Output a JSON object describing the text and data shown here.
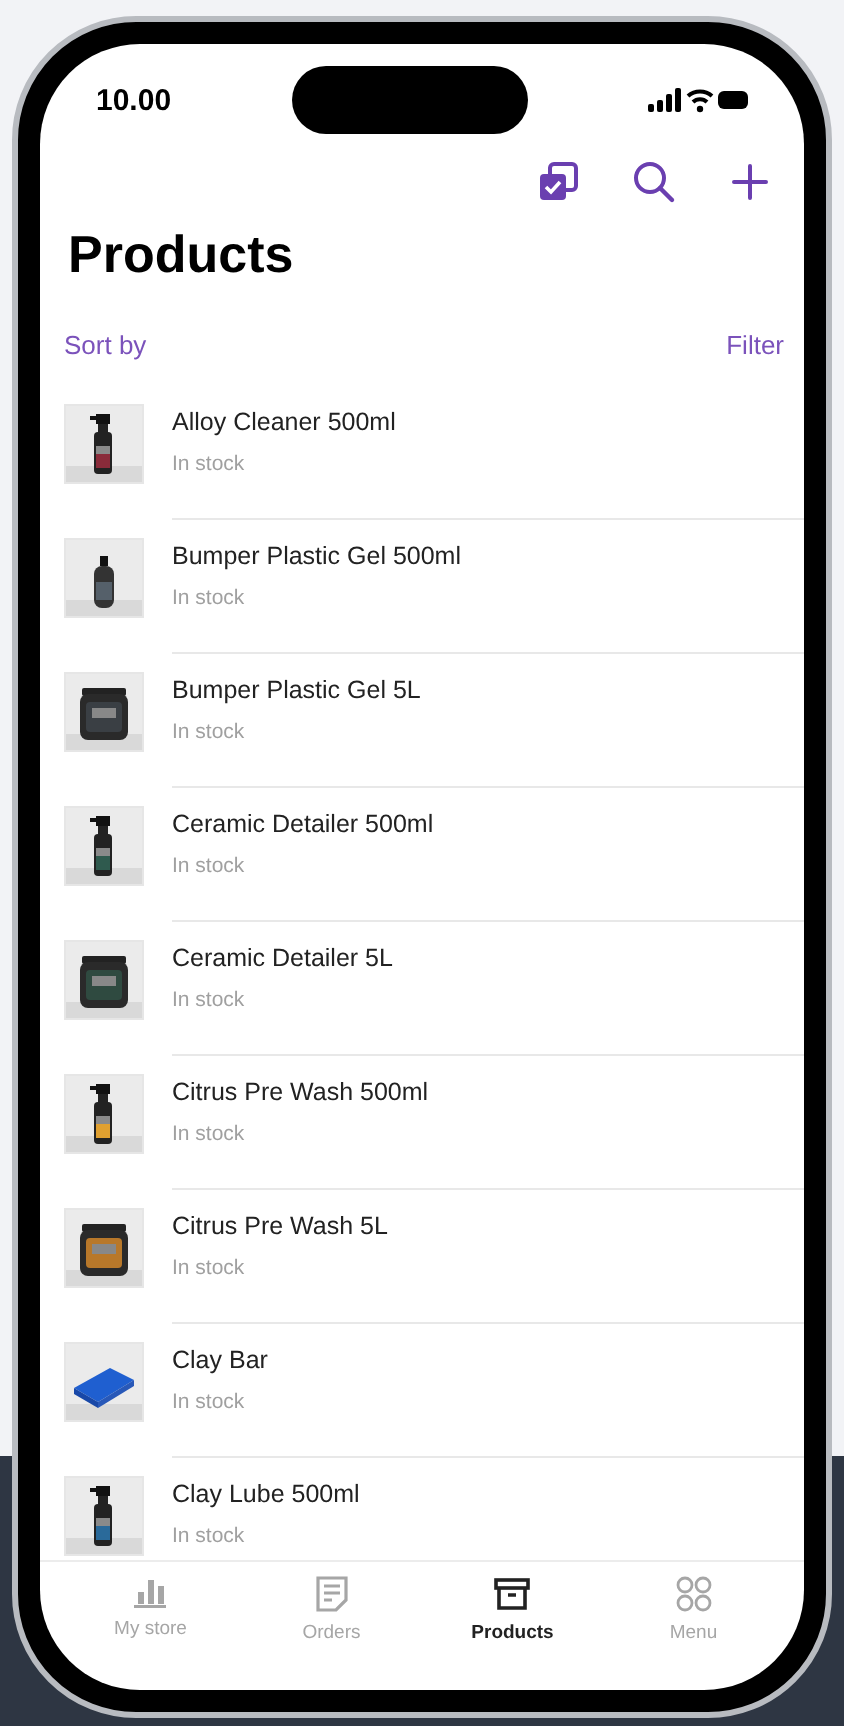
{
  "status_bar": {
    "time": "10.00"
  },
  "title": "Products",
  "sort_label": "Sort by",
  "filter_label": "Filter",
  "products": [
    {
      "name": "Alloy Cleaner 500ml",
      "status": "In stock"
    },
    {
      "name": "Bumper Plastic Gel 500ml",
      "status": "In stock"
    },
    {
      "name": "Bumper Plastic Gel 5L",
      "status": "In stock"
    },
    {
      "name": "Ceramic Detailer 500ml",
      "status": "In stock"
    },
    {
      "name": "Ceramic Detailer 5L",
      "status": "In stock"
    },
    {
      "name": "Citrus Pre Wash 500ml",
      "status": "In stock"
    },
    {
      "name": "Citrus Pre Wash 5L",
      "status": "In stock"
    },
    {
      "name": "Clay Bar",
      "status": "In stock"
    },
    {
      "name": "Clay Lube 500ml",
      "status": "In stock"
    }
  ],
  "tab_bar": [
    {
      "label": "My store",
      "kind": "store",
      "selected": false
    },
    {
      "label": "Orders",
      "kind": "orders",
      "selected": false
    },
    {
      "label": "Products",
      "kind": "products",
      "selected": true
    },
    {
      "label": "Menu",
      "kind": "menu",
      "selected": false
    }
  ]
}
